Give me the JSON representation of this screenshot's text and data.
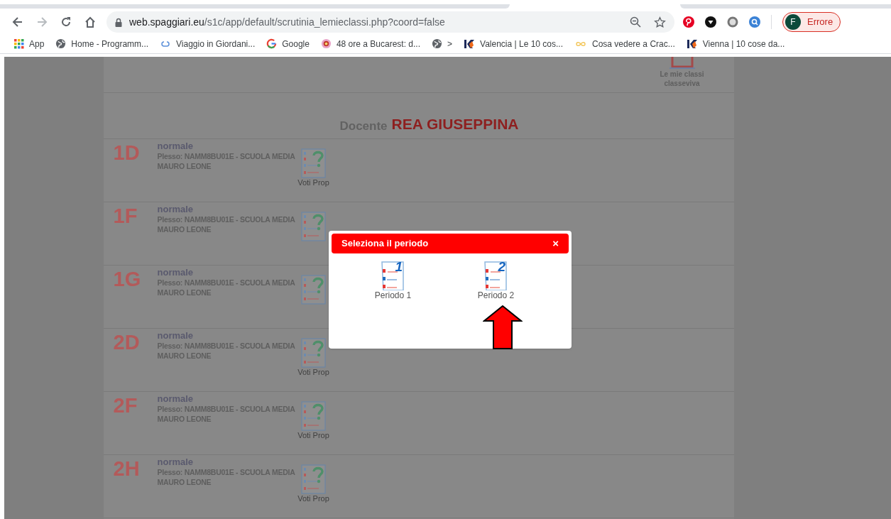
{
  "browser": {
    "url_host": "web.spaggiari.eu",
    "url_path": "/s1c/app/default/scrutinia_lemieclassi.php?coord=false",
    "profile_initial": "F",
    "profile_status": "Errore",
    "bookmarks": [
      {
        "label": "App",
        "kind": "apps"
      },
      {
        "label": "Home - Programm...",
        "kind": "globe"
      },
      {
        "label": "Viaggio in Giordani...",
        "kind": "loop"
      },
      {
        "label": "Google",
        "kind": "google"
      },
      {
        "label": "48 ore a Bucarest: d...",
        "kind": "flower"
      },
      {
        "label": ">",
        "kind": "globe"
      },
      {
        "label": "Valencia | Le 10 cos...",
        "kind": "k"
      },
      {
        "label": "Cosa vedere a Crac...",
        "kind": "ring"
      },
      {
        "label": "Vienna | 10 cose da...",
        "kind": "k"
      }
    ]
  },
  "page": {
    "top_link": {
      "line1": "Le mie classi",
      "line2": "classeviva"
    },
    "heading_prefix": "Docente",
    "teacher": "REA GIUSEPPINA",
    "classes": [
      {
        "code": "1D",
        "type": "normale",
        "plesso": "Plesso: NAMM8BU01E - SCUOLA MEDIA MAURO LEONE",
        "action_label": "Voti Prop"
      },
      {
        "code": "1F",
        "type": "normale",
        "plesso": "Plesso: NAMM8BU01E - SCUOLA MEDIA MAURO LEONE"
      },
      {
        "code": "1G",
        "type": "normale",
        "plesso": "Plesso: NAMM8BU01E - SCUOLA MEDIA MAURO LEONE"
      },
      {
        "code": "2D",
        "type": "normale",
        "plesso": "Plesso: NAMM8BU01E - SCUOLA MEDIA MAURO LEONE",
        "action_label": "Voti Prop"
      },
      {
        "code": "2F",
        "type": "normale",
        "plesso": "Plesso: NAMM8BU01E - SCUOLA MEDIA MAURO LEONE",
        "action_label": "Voti Prop"
      },
      {
        "code": "2H",
        "type": "normale",
        "plesso": "Plesso: NAMM8BU01E - SCUOLA MEDIA MAURO LEONE",
        "action_label": "Voti Prop"
      }
    ]
  },
  "dialog": {
    "title": "Seleziona il periodo",
    "close": "×",
    "periods": [
      {
        "number": "1",
        "label": "Periodo 1",
        "highlighted": false
      },
      {
        "number": "2",
        "label": "Periodo 2",
        "highlighted": true
      }
    ]
  }
}
